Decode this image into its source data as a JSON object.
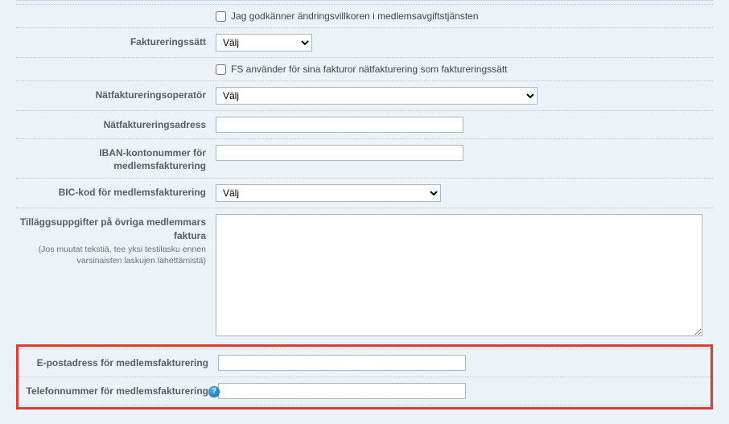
{
  "terms": {
    "label": "Jag godkänner ändringsvillkoren i medlemsavgiftstjänsten"
  },
  "invoicing_method": {
    "label": "Faktureringssätt",
    "value": "Välj"
  },
  "einvoice_note": {
    "label": "FS använder för sina fakturor nätfakturering som faktureringssätt"
  },
  "einvoice_operator": {
    "label": "Nätfaktureringsoperatör",
    "value": "Välj"
  },
  "einvoice_address": {
    "label": "Nätfaktureringsadress",
    "value": ""
  },
  "iban": {
    "label": "IBAN-kontonummer för medlemsfakturering",
    "value": ""
  },
  "bic": {
    "label": "BIC-kod för medlemsfakturering",
    "value": "Välj"
  },
  "extra_info": {
    "label": "Tilläggsuppgifter på övriga medlemmars faktura",
    "hint": "(Jos muutat tekstiä, tee yksi testilasku ennen varsinaisten laskujen lähettämistä)",
    "value": ""
  },
  "email": {
    "label": "E-postadress för medlemsfakturering",
    "value": ""
  },
  "phone": {
    "label": "Telefonnummer för medlemsfakturering",
    "value": "",
    "help": "?"
  }
}
